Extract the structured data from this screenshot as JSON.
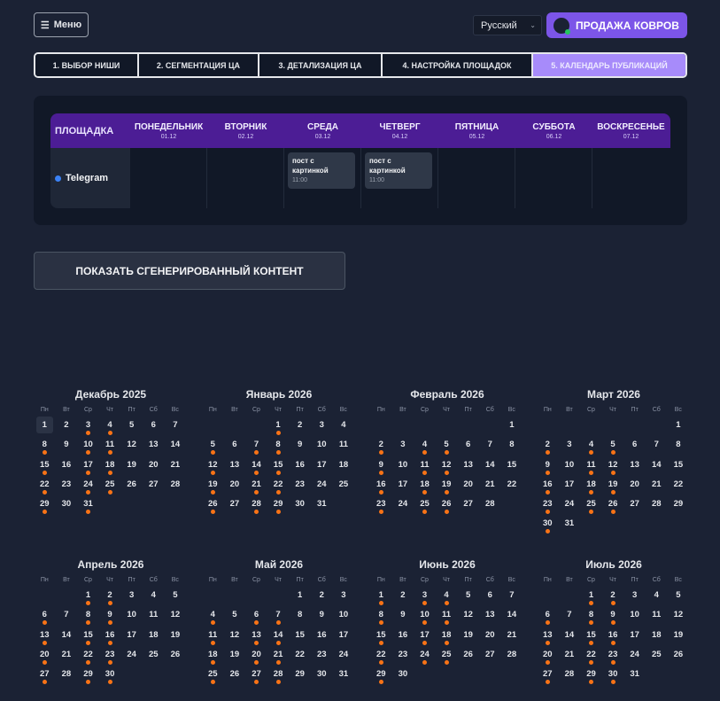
{
  "header": {
    "menu_label": "Меню",
    "language": "Русский",
    "brand": "ПРОДАЖА КОВРОВ"
  },
  "tabs": [
    {
      "label": "1. ВЫБОР НИШИ",
      "active": false
    },
    {
      "label": "2. СЕГМЕНТАЦИЯ ЦА",
      "active": false
    },
    {
      "label": "3. ДЕТАЛИЗАЦИЯ ЦА",
      "active": false
    },
    {
      "label": "4. НАСТРОЙКА ПЛОЩАДОК",
      "active": false
    },
    {
      "label": "5. КАЛЕНДАРЬ ПУБЛИКАЦИЙ",
      "active": true
    }
  ],
  "schedule": {
    "platform_header": "ПЛОЩАДКА",
    "days": [
      {
        "name": "ПОНЕДЕЛЬНИК",
        "date": "01.12"
      },
      {
        "name": "ВТОРНИК",
        "date": "02.12"
      },
      {
        "name": "СРЕДА",
        "date": "03.12"
      },
      {
        "name": "ЧЕТВЕРГ",
        "date": "04.12"
      },
      {
        "name": "ПЯТНИЦА",
        "date": "05.12"
      },
      {
        "name": "СУББОТА",
        "date": "06.12"
      },
      {
        "name": "ВОСКРЕСЕНЬЕ",
        "date": "07.12"
      }
    ],
    "platform": "Telegram",
    "posts": [
      {
        "day": 2,
        "title": "пост с картинкой",
        "time": "11:00"
      },
      {
        "day": 3,
        "title": "пост с картинкой",
        "time": "11:00"
      }
    ]
  },
  "show_button": "ПОКАЗАТЬ СГЕНЕРИРОВАННЫЙ КОНТЕНТ",
  "weekdays": [
    "Пн",
    "Вт",
    "Ср",
    "Чт",
    "Пт",
    "Сб",
    "Вс"
  ],
  "colors": {
    "accent": "#7c55e8",
    "dot": "#f97316",
    "header": "#4c1d95"
  },
  "calendar": {
    "today": {
      "month": 0,
      "day": 1
    },
    "months": [
      {
        "title": "Декабрь 2025",
        "offset": 0,
        "days": 31,
        "posts": [
          3,
          4,
          8,
          10,
          11,
          15,
          17,
          18,
          22,
          24,
          25,
          29,
          31
        ]
      },
      {
        "title": "Январь 2026",
        "offset": 3,
        "days": 31,
        "posts": [
          1,
          5,
          7,
          8,
          12,
          14,
          15,
          19,
          21,
          22,
          26,
          28,
          29
        ]
      },
      {
        "title": "Февраль 2026",
        "offset": 6,
        "days": 28,
        "posts": [
          2,
          4,
          5,
          9,
          11,
          12,
          16,
          18,
          19,
          23,
          25,
          26
        ]
      },
      {
        "title": "Март 2026",
        "offset": 6,
        "days": 31,
        "posts": [
          2,
          4,
          5,
          9,
          11,
          12,
          16,
          18,
          19,
          23,
          25,
          26,
          30
        ]
      },
      {
        "title": "Апрель 2026",
        "offset": 2,
        "days": 30,
        "posts": [
          1,
          2,
          6,
          8,
          9,
          13,
          15,
          16,
          20,
          22,
          23,
          27,
          29,
          30
        ]
      },
      {
        "title": "Май 2026",
        "offset": 4,
        "days": 31,
        "posts": [
          4,
          6,
          7,
          11,
          13,
          14,
          18,
          20,
          21,
          25,
          27,
          28
        ]
      },
      {
        "title": "Июнь 2026",
        "offset": 0,
        "days": 30,
        "posts": [
          1,
          3,
          4,
          8,
          10,
          11,
          15,
          17,
          18,
          22,
          24,
          25,
          29
        ]
      },
      {
        "title": "Июль 2026",
        "offset": 2,
        "days": 31,
        "posts": [
          1,
          2,
          6,
          8,
          9,
          13,
          15,
          16,
          20,
          22,
          23,
          27,
          29,
          30
        ]
      }
    ]
  }
}
